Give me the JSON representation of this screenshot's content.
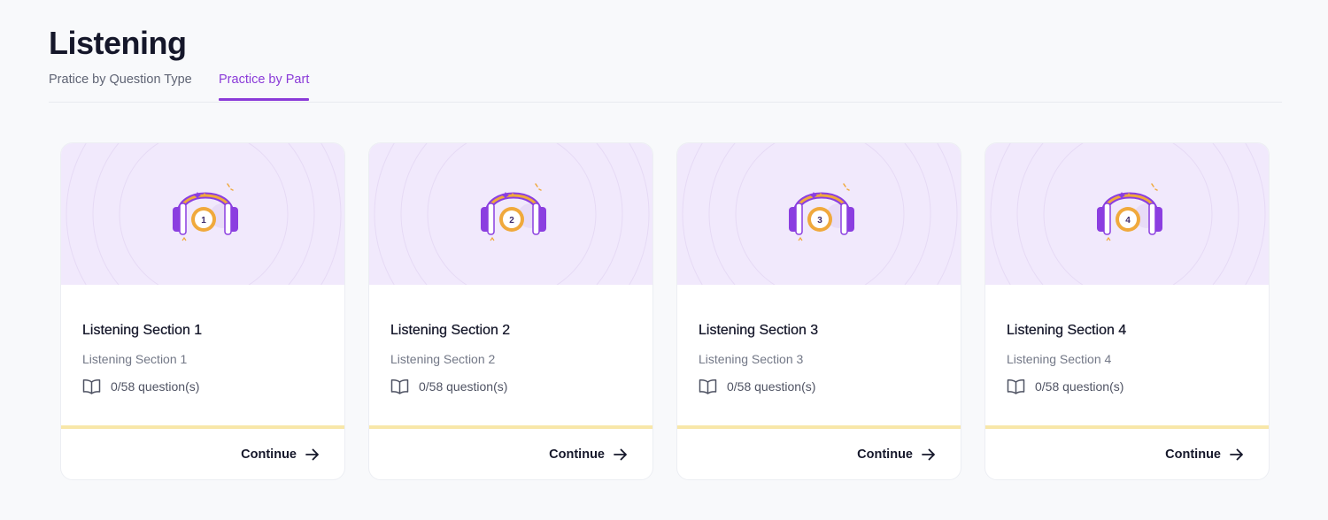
{
  "page": {
    "title": "Listening"
  },
  "tabs": [
    {
      "label": "Pratice by Question Type",
      "active": false
    },
    {
      "label": "Practice by Part",
      "active": true
    }
  ],
  "colors": {
    "accent": "#8a3ad8",
    "banner_bg": "#f1e9fc",
    "progress_track": "#f8e7a9",
    "headphone_purple": "#8b3ee0",
    "headphone_orange": "#f0a93c"
  },
  "cards": [
    {
      "badge": "1",
      "title": "Listening Section 1",
      "subtitle": "Listening Section 1",
      "count": "0/58 question(s)",
      "progress": 0,
      "cta": "Continue",
      "icon": "headphones-icon"
    },
    {
      "badge": "2",
      "title": "Listening Section 2",
      "subtitle": "Listening Section 2",
      "count": "0/58 question(s)",
      "progress": 0,
      "cta": "Continue",
      "icon": "headphones-icon"
    },
    {
      "badge": "3",
      "title": "Listening Section 3",
      "subtitle": "Listening Section 3",
      "count": "0/58 question(s)",
      "progress": 0,
      "cta": "Continue",
      "icon": "headphones-icon"
    },
    {
      "badge": "4",
      "title": "Listening Section 4",
      "subtitle": "Listening Section 4",
      "count": "0/58 question(s)",
      "progress": 0,
      "cta": "Continue",
      "icon": "headphones-icon"
    }
  ],
  "icons": {
    "count": "book-icon",
    "cta": "arrow-right-icon"
  }
}
